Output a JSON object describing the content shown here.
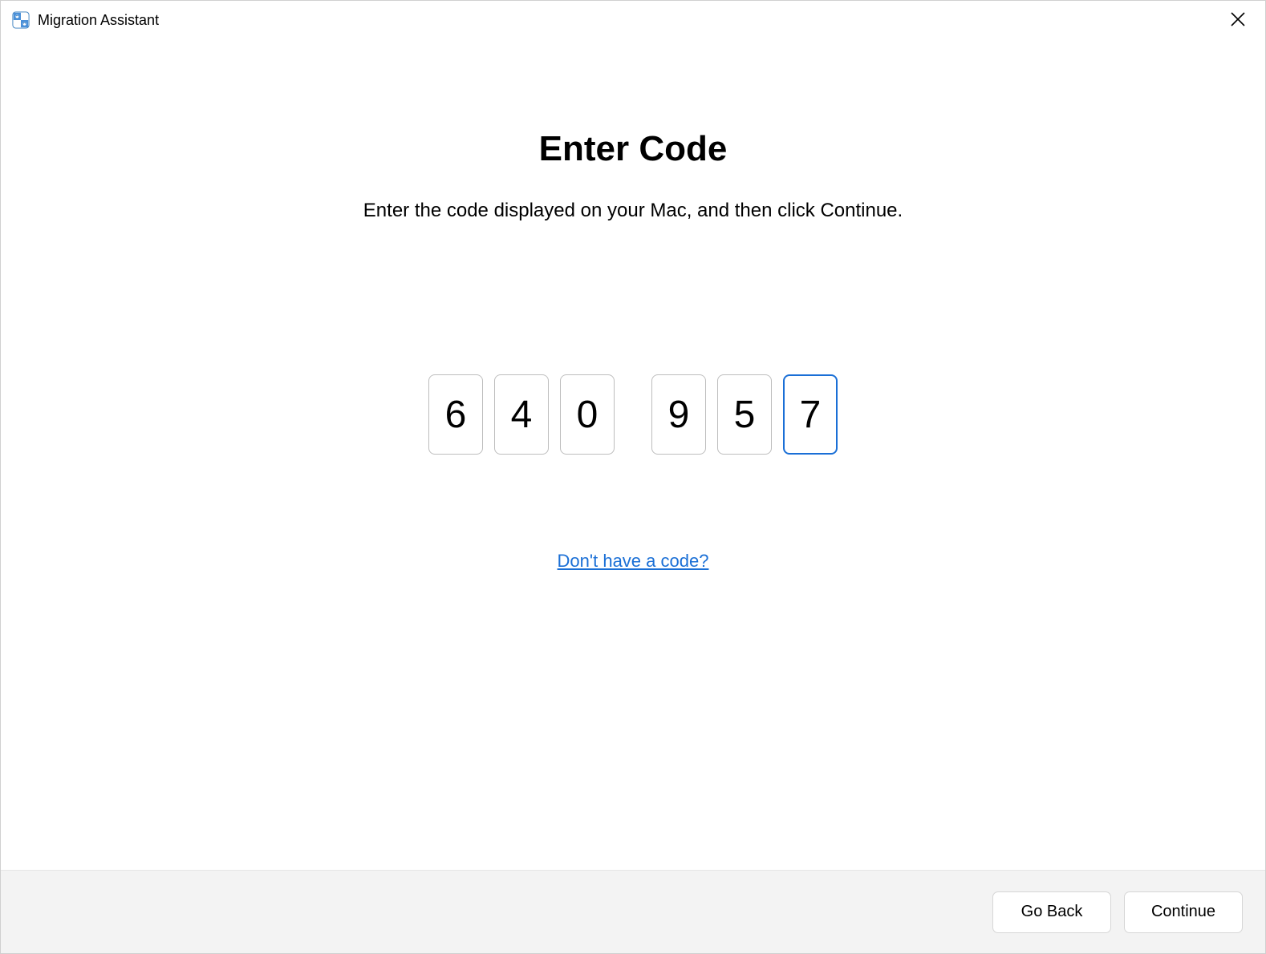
{
  "titlebar": {
    "app_title": "Migration Assistant"
  },
  "main": {
    "heading": "Enter Code",
    "subheading": "Enter the code displayed on your Mac, and then click Continue.",
    "code_digits": [
      "6",
      "4",
      "0",
      "9",
      "5",
      "7"
    ],
    "active_index": 5,
    "help_link_label": "Don't have a code?"
  },
  "footer": {
    "go_back_label": "Go Back",
    "continue_label": "Continue"
  }
}
